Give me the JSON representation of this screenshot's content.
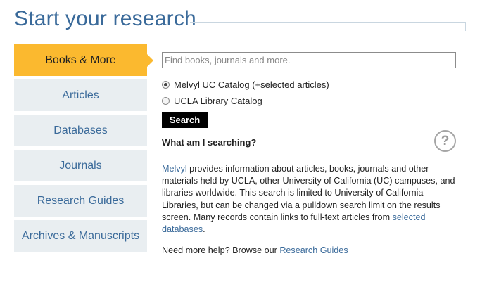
{
  "header": {
    "title": "Start your research"
  },
  "sidebar": {
    "items": [
      {
        "label": "Books & More",
        "active": true
      },
      {
        "label": "Articles",
        "active": false
      },
      {
        "label": "Databases",
        "active": false
      },
      {
        "label": "Journals",
        "active": false
      },
      {
        "label": "Research Guides",
        "active": false
      },
      {
        "label": "Archives & Manuscripts",
        "active": false
      }
    ]
  },
  "search": {
    "placeholder": "Find books, journals and more.",
    "value": "",
    "options": [
      {
        "label": "Melvyl UC Catalog (+selected articles)",
        "checked": true
      },
      {
        "label": "UCLA Library Catalog",
        "checked": false
      }
    ],
    "button_label": "Search"
  },
  "info": {
    "question": "What am I searching?",
    "help_icon": "question-mark-icon",
    "help_glyph": "?",
    "description_link_start": "Melvyl",
    "description_text": " provides information about articles, books, journals and other materials held by UCLA, other University of California (UC) campuses, and libraries worldwide. This search is limited to University of California Libraries, but can be changed via a pulldown search limit on the results screen. Many records contain links to full-text articles from ",
    "description_link_end": "selected databases",
    "description_period": ".",
    "help_prefix": "Need more help? Browse our ",
    "help_link": "Research Guides"
  },
  "colors": {
    "accent": "#fbb92f",
    "link": "#3a6a9a",
    "tab_bg": "#e9eef1"
  }
}
